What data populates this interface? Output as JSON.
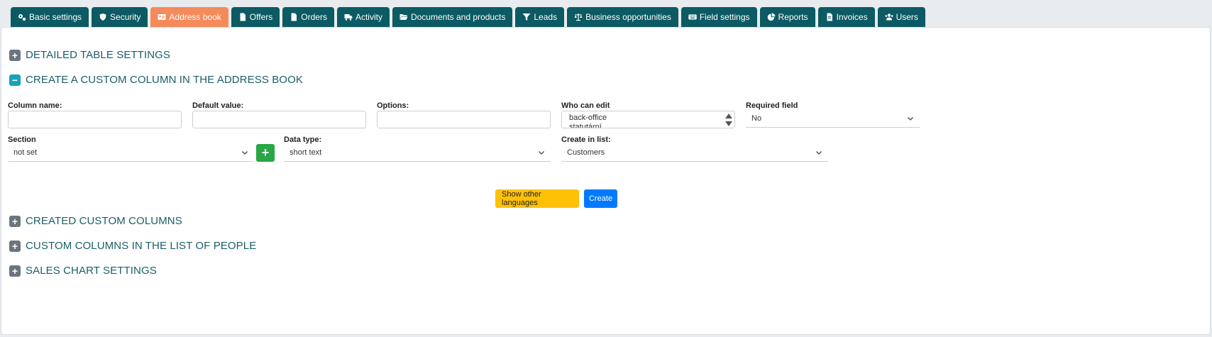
{
  "tabs": [
    {
      "label": "Basic settings",
      "icon": "gears-icon"
    },
    {
      "label": "Security",
      "icon": "shield-icon"
    },
    {
      "label": "Address book",
      "icon": "address-card-icon",
      "active": true
    },
    {
      "label": "Offers",
      "icon": "file-icon"
    },
    {
      "label": "Orders",
      "icon": "file-icon"
    },
    {
      "label": "Activity",
      "icon": "truck-icon"
    },
    {
      "label": "Documents and products",
      "icon": "folder-open-icon"
    },
    {
      "label": "Leads",
      "icon": "funnel-icon"
    },
    {
      "label": "Business opportunities",
      "icon": "scale-icon"
    },
    {
      "label": "Field settings",
      "icon": "keyboard-icon"
    },
    {
      "label": "Reports",
      "icon": "pie-chart-icon"
    },
    {
      "label": "Invoices",
      "icon": "invoice-icon"
    },
    {
      "label": "Users",
      "icon": "users-icon"
    }
  ],
  "sections": {
    "detailed": {
      "title": "DETAILED TABLE SETTINGS",
      "toggle": "+"
    },
    "create": {
      "title": "CREATE A CUSTOM COLUMN IN THE ADDRESS BOOK",
      "toggle": "−"
    },
    "created": {
      "title": "CREATED CUSTOM COLUMNS",
      "toggle": "+"
    },
    "people": {
      "title": "CUSTOM COLUMNS IN THE LIST OF PEOPLE",
      "toggle": "+"
    },
    "sales": {
      "title": "SALES CHART SETTINGS",
      "toggle": "+"
    }
  },
  "form": {
    "column_name_label": "Column name:",
    "column_name_value": "",
    "default_value_label": "Default value:",
    "default_value_value": "",
    "options_label": "Options:",
    "options_value": "",
    "who_can_edit_label": "Who can edit",
    "who_can_edit_options": [
      "back-office",
      "statutární"
    ],
    "required_label": "Required field",
    "required_value": "No",
    "section_label": "Section",
    "section_value": "not set",
    "add_section_label": "+",
    "data_type_label": "Data type:",
    "data_type_value": "short text",
    "create_in_list_label": "Create in list:",
    "create_in_list_value": "Customers"
  },
  "buttons": {
    "show_languages": "Show other languages",
    "create": "Create"
  },
  "colors": {
    "tab": "#0c5a63",
    "tab_active": "#f58a5b",
    "section_title": "#1b5e69",
    "yellow_button": "#ffc107",
    "blue_button": "#007bff",
    "green_button": "#28a745"
  }
}
